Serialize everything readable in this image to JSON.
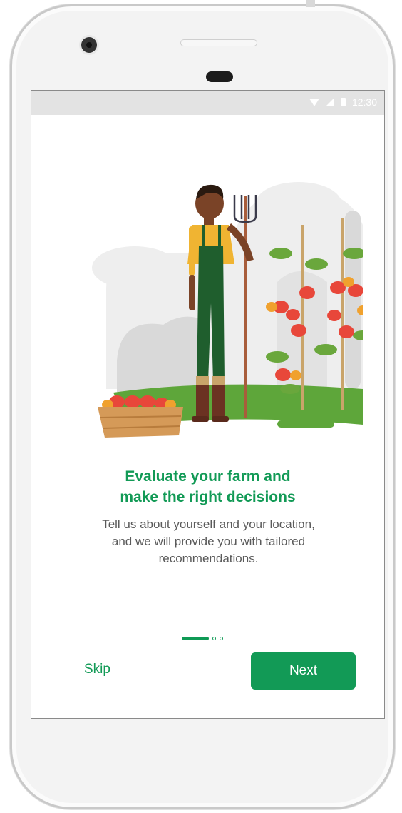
{
  "status_bar": {
    "time": "12:30"
  },
  "onboarding": {
    "title_line1": "Evaluate your farm and",
    "title_line2": "make the right decisions",
    "description_line1": "Tell us about yourself and your location,",
    "description_line2": "and we will provide you with tailored",
    "description_line3": "recommendations.",
    "page_indicator": {
      "current": 1,
      "total": 3
    }
  },
  "actions": {
    "skip_label": "Skip",
    "next_label": "Next"
  },
  "colors": {
    "brand_green": "#129a56",
    "text_gray": "#5a5a5a",
    "status_bar": "#e3e3e3"
  },
  "icons": [
    "wifi-icon",
    "signal-icon",
    "battery-icon"
  ]
}
